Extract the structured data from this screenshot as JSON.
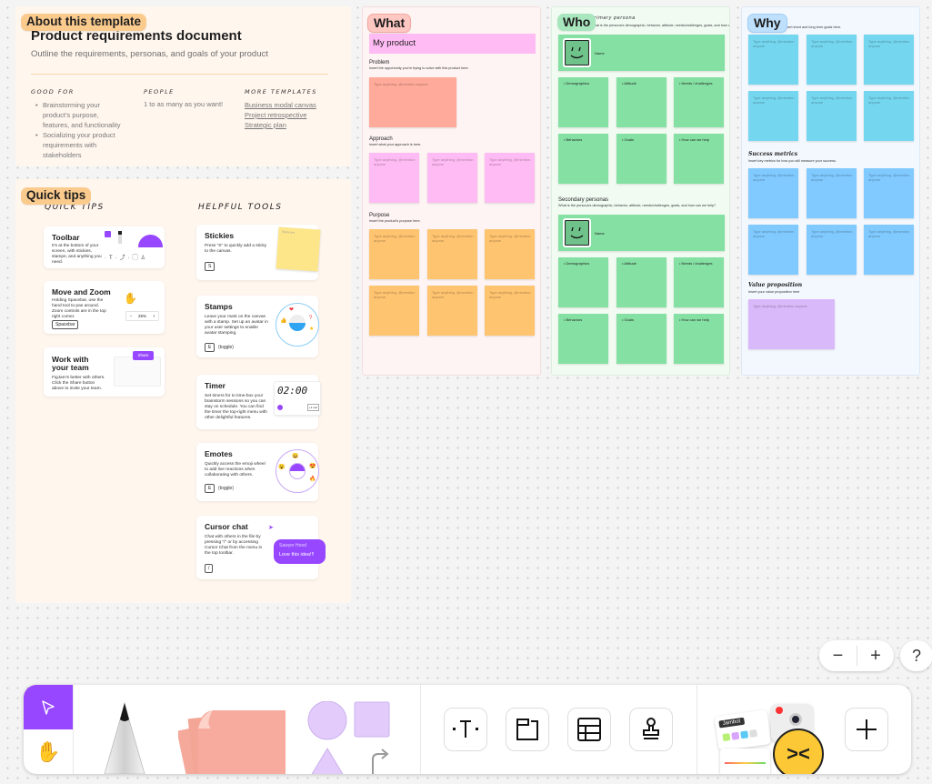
{
  "about": {
    "tag": "About this template",
    "title": "Product requirements document",
    "subtitle": "Outline the requirements, personas, and goals of your product",
    "good_for_heading": "Good for",
    "good_for": [
      "Brainstorming your product’s purpose, features, and functionality",
      "Socializing your product requirements with stakeholders"
    ],
    "people_heading": "People",
    "people": "1 to as many as you want!",
    "more_heading": "More templates",
    "more_links": [
      "Business modal canvas",
      "Project retrospective",
      "Strategic plan"
    ]
  },
  "tips": {
    "tag": "Quick tips",
    "quick_heading": "Quick tips",
    "tools_heading": "Helpful tools",
    "quick": [
      {
        "title": "Toolbar",
        "desc": "It's at the bottom of your screen, with stickies, stamps, and anything you need."
      },
      {
        "title": "Move and Zoom",
        "desc": "Holding Spacebar, use the hand tool to pan around. Zoom controls are in the top right corner.",
        "key": "Spacebar",
        "zoom_value": "25%"
      },
      {
        "title": "Work with your team",
        "desc": "FigJam's better with others. Click the Share button above to invite your team.",
        "share_label": "Share"
      }
    ],
    "tools": [
      {
        "title": "Stickies",
        "desc": "Press \"S\" to quickly add a sticky to the canvas.",
        "key": "S",
        "sticky_text": "Sticky text"
      },
      {
        "title": "Stamps",
        "desc": "Leave your mark on the canvas with a stamp. Set up an avatar in your user settings to enable avatar stamping.",
        "key": "E",
        "key_label": "(toggle)"
      },
      {
        "title": "Timer",
        "desc": "Set timers for to time-box your brainstorm sessions so you can stay on schedule. You can find the timer the top-right menu with other delightful features.",
        "timer_value": "02:00",
        "timer_sub": "New timer",
        "timer_btn": "+1 min"
      },
      {
        "title": "Emotes",
        "desc": "Quickly access the emoji wheel to add live reactions when collaborating with others.",
        "key": "E",
        "key_label": "(toggle)"
      },
      {
        "title": "Cursor chat",
        "desc": "Chat with others in the file by pressing \"/\" or by accessing Cursor Chat from the menu in the top toolbar.",
        "key": "/",
        "chat_name": "Sawyer Hood",
        "chat_msg": "Love this idea!!!"
      }
    ]
  },
  "what": {
    "tag": "What",
    "product": "My product",
    "problem_h": "Problem",
    "problem_d": "Insert the opportunity you're trying to solve with this product here.",
    "approach_h": "Approach",
    "approach_d": "Insert what your approach is here.",
    "purpose_h": "Purpose",
    "purpose_d": "Insert the product's purpose here.",
    "placeholder": "Type anything, @mention anyone"
  },
  "who": {
    "tag": "Who",
    "primary_h": "Primary persona",
    "primary_d": "What is the persona's demographic, behavior, attitude, needs/challenges, goals, and how can we help?",
    "secondary_h": "Secondary personas",
    "secondary_d": "What is the persona's demographic, behavior, attitude, needs/challenges, goals, and how can we help?",
    "name_label": "Name",
    "labels": [
      "Demographics",
      "Attitude",
      "Needs / challenges",
      "Behaviors",
      "Goals",
      "How can we help"
    ]
  },
  "why": {
    "tag": "Why",
    "goals_d": "Insert short and long term goals here.",
    "metrics_h": "Success metrics",
    "metrics_d": "Insert key metrics for how you will measure your success.",
    "value_h": "Value proposition",
    "value_d": "Insert your value proposition here",
    "placeholder": "Type anything, @mention anyone"
  },
  "toolbar": {
    "tools": [
      "move-tool",
      "hand-tool",
      "marker-tool",
      "sticky-tool",
      "shape-tool",
      "text-tool",
      "section-tool",
      "table-tool",
      "stamp-tool",
      "widgets",
      "more-tools"
    ],
    "jambot_label": "Jambot",
    "accent": "#9747ff"
  },
  "zoom": {
    "minus": "−",
    "plus": "+",
    "help": "?"
  }
}
